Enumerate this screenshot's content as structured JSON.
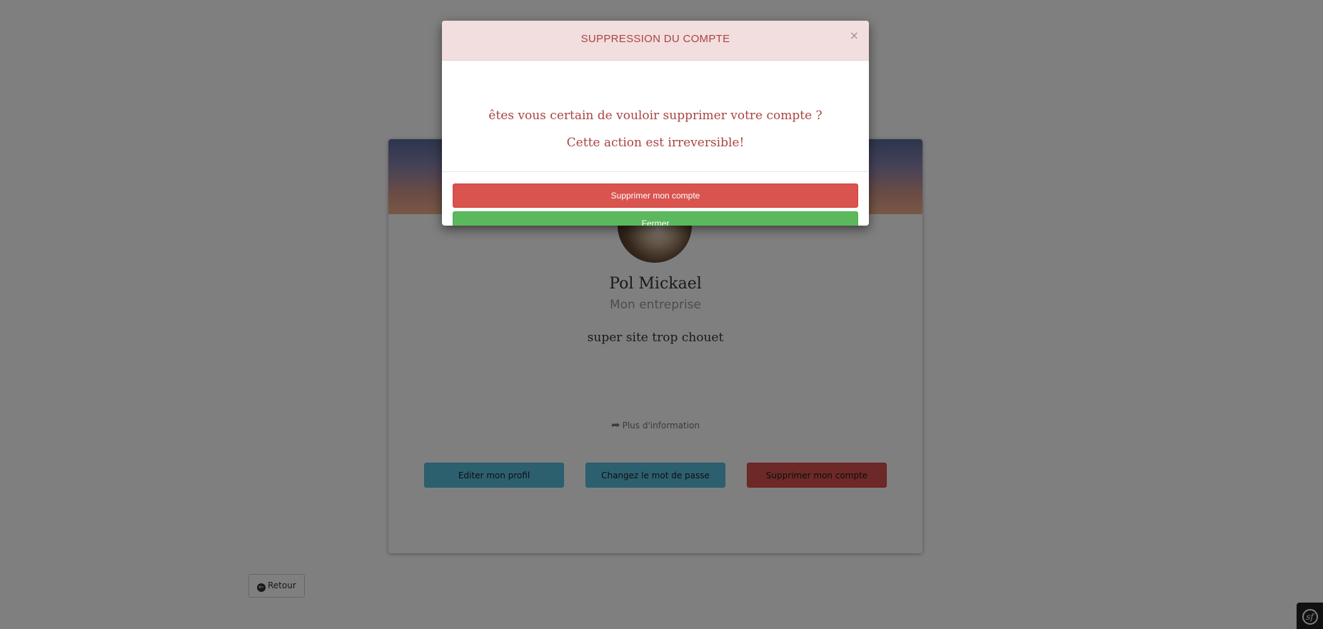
{
  "profile": {
    "name": "Pol Mickael",
    "company": "Mon entreprise",
    "bio": "super site trop chouet",
    "more_info": "Plus d'information",
    "actions": {
      "edit": "Editer mon profil",
      "password": "Changez le mot de passe",
      "delete": "Supprimer mon compte"
    },
    "back": "Retour"
  },
  "modal": {
    "title": "SUPPRESSION DU COMPTE",
    "close_symbol": "×",
    "line1": "êtes vous certain de vouloir supprimer votre compte ?",
    "line2": "Cette action est irreversible!",
    "confirm": "Supprimer mon compte",
    "dismiss": "Fermer"
  },
  "icons": {
    "more_info": "share-icon",
    "back": "arrow-left-circle-icon",
    "toolbar": "symfony-icon"
  },
  "colors": {
    "modal_header_bg": "#f2dede",
    "modal_text": "#a94442",
    "danger": "#d9534f",
    "success": "#5cb85c",
    "info": "#5bc0de"
  },
  "toolbar": {
    "glyph": "sf"
  }
}
